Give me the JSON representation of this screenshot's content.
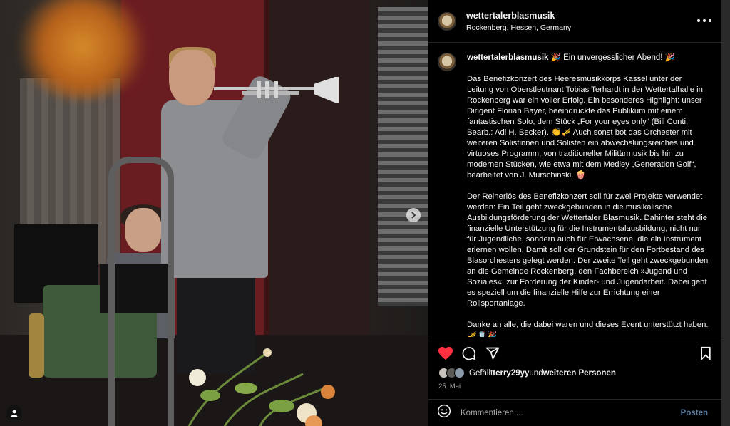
{
  "post": {
    "username": "wettertalerblasmusik",
    "location": "Rockenberg, Hessen, Germany",
    "caption": {
      "username": "wettertalerblasmusik",
      "title": " 🎉 Ein unvergesslicher Abend! 🎉",
      "paragraph1": "Das Benefizkonzert des Heeresmusikkorps Kassel unter der Leitung von Oberstleutnant Tobias Terhardt in der Wettertalhalle in Rockenberg war ein voller Erfolg. Ein besonderes Highlight: unser Dirigent Florian Bayer, beeindruckte das Publikum mit einem fantastischen Solo, dem Stück „For your eyes only“ (Bill Conti, Bearb.: Adi H. Becker). 👏🎺 Auch sonst bot das Orchester mit weiteren Solistinnen und Solisten ein abwechslungsreiches und virtuoses Programm, von traditioneller Militärmusik bis hin zu modernen Stücken, wie etwa mit dem Medley „Generation Golf“, bearbeitet von J. Murschinski. 🍿",
      "paragraph2": "Der Reinerlös des Benefizkonzert soll für zwei Projekte verwendet werden: Ein Teil geht zweckgebunden in die musikalische Ausbildungsförderung der Wettertaler Blasmusik. Dahinter steht die finanzielle Unterstützung für die Instrumentalausbildung, nicht nur für Jugendliche, sondern auch für Erwachsene, die ein Instrument erlernen wollen. Damit soll der Grundstein für den Fortbestand des Blasorchesters gelegt werden. Der zweite Teil geht zweckgebunden an die Gemeinde Rockenberg, den Fachbereich »Jugend und Soziales«, zur Forderung der Kinder- und Jugendarbeit. Dabei geht es speziell um die finanzielle Hilfe zur Errichtung einer Rollsportanlage.",
      "paragraph3": "Danke an alle, die dabei waren und dieses Event unterstützt haben. 🎺🥤🎉"
    },
    "likes": {
      "prefix": "Gefällt ",
      "user": "terry29yy",
      "middle": " und ",
      "others": "weiteren Personen"
    },
    "date": "25. Mai",
    "comment_placeholder": "Kommentieren ...",
    "post_label": "Posten",
    "colors": {
      "heart": "#ff3040",
      "post_button": "#5a7c9e",
      "background": "#000000"
    },
    "icons": [
      "more-options-icon",
      "heart-icon",
      "comment-icon",
      "share-icon",
      "bookmark-icon",
      "emoji-icon",
      "next-arrow-icon",
      "user-tag-icon"
    ]
  }
}
